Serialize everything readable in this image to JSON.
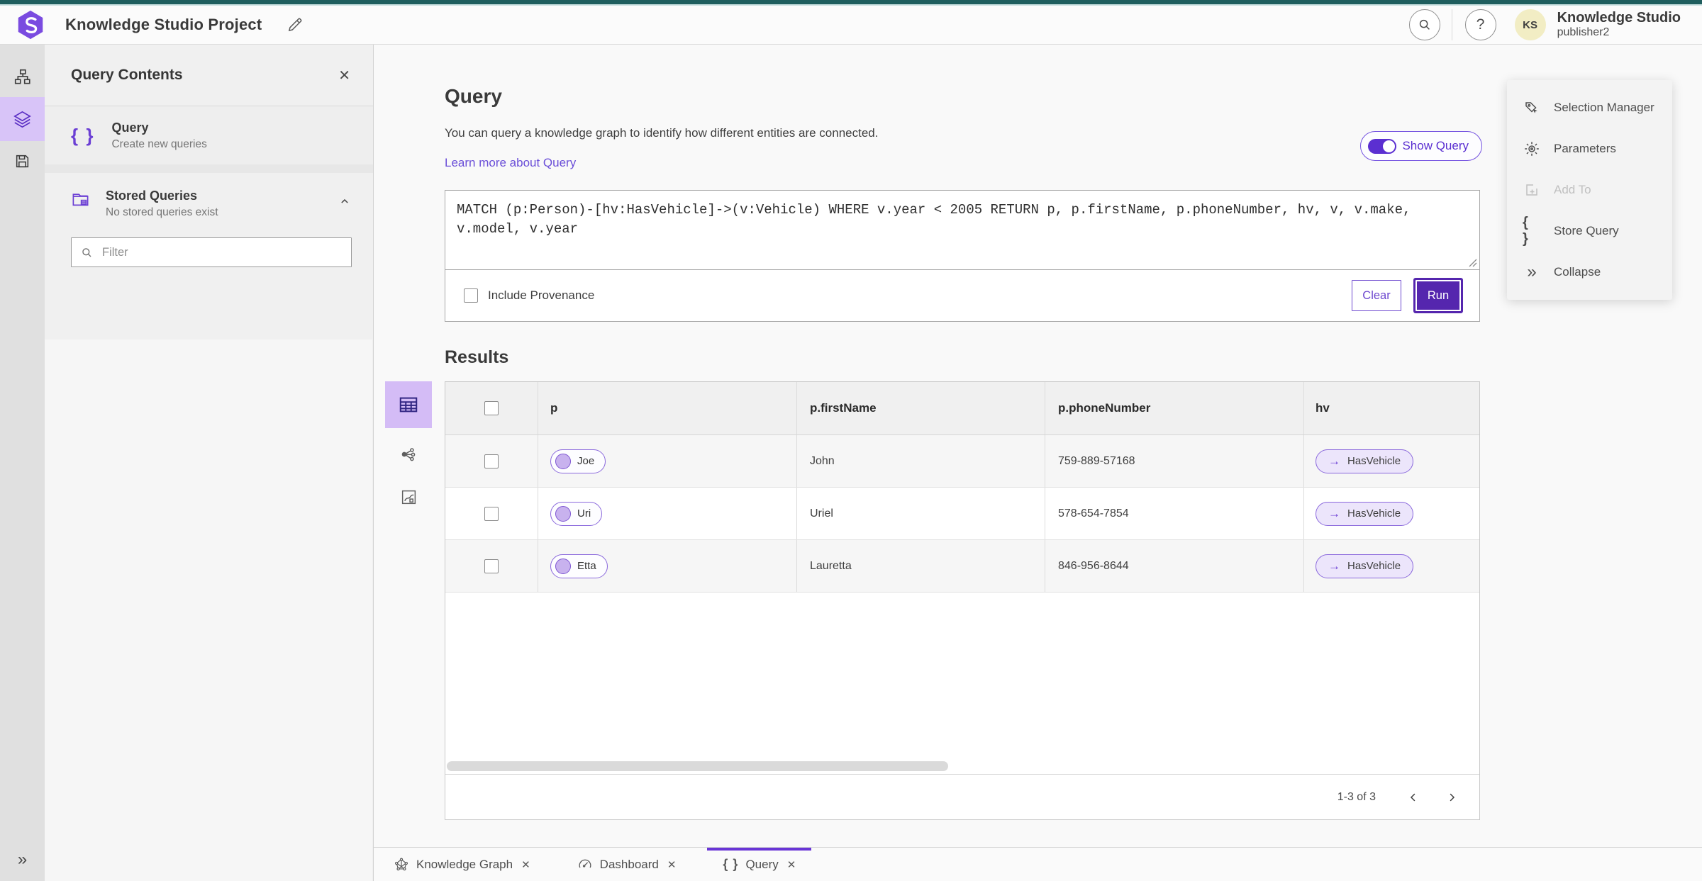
{
  "app": {
    "top_title": "Knowledge Studio Project",
    "product_name": "Knowledge Studio",
    "user_name": "publisher2",
    "avatar_initials": "KS"
  },
  "icons": {
    "braces": "{ }",
    "close": "✕",
    "help": "?",
    "collapse": "»",
    "expand": "»",
    "arrow_right": "→"
  },
  "left_panel": {
    "title": "Query Contents",
    "query_item": {
      "label": "Query",
      "description": "Create new queries"
    },
    "stored_queries": {
      "label": "Stored Queries",
      "description": "No stored queries exist"
    },
    "filter_placeholder": "Filter"
  },
  "query_section": {
    "title": "Query",
    "description": "You can query a knowledge graph to identify how different entities are connected.",
    "learn_more_label": "Learn more about Query",
    "show_query_label": "Show Query",
    "query_text": "MATCH (p:Person)-[hv:HasVehicle]->(v:Vehicle) WHERE v.year < 2005 RETURN p, p.firstName, p.phoneNumber, hv, v, v.make, v.model, v.year",
    "include_provenance_label": "Include Provenance",
    "clear_label": "Clear",
    "run_label": "Run"
  },
  "results": {
    "title": "Results",
    "columns": [
      "p",
      "p.firstName",
      "p.phoneNumber",
      "hv"
    ],
    "rows": [
      {
        "p": "Joe",
        "firstName": "John",
        "phoneNumber": "759-889-57168",
        "hv": "HasVehicle"
      },
      {
        "p": "Uri",
        "firstName": "Uriel",
        "phoneNumber": "578-654-7854",
        "hv": "HasVehicle"
      },
      {
        "p": "Etta",
        "firstName": "Lauretta",
        "phoneNumber": "846-956-8644",
        "hv": "HasVehicle"
      }
    ],
    "pagination_label": "1-3 of 3"
  },
  "actions_panel": {
    "selection_manager": "Selection Manager",
    "parameters": "Parameters",
    "add_to": "Add To",
    "store_query": "Store Query",
    "collapse": "Collapse"
  },
  "bottom_tabs": [
    {
      "label": "Knowledge Graph"
    },
    {
      "label": "Dashboard"
    },
    {
      "label": "Query"
    }
  ],
  "colors": {
    "accent_purple": "#5526ae",
    "toggle_purple": "#5b2fd1",
    "pill_border_purple": "#8a68dc",
    "link_purple": "#6b4fd8",
    "teal_top": "#1f5e5e",
    "rail_selected_bg": "#d8c4f8",
    "avatar_bg": "#f2edc4"
  }
}
